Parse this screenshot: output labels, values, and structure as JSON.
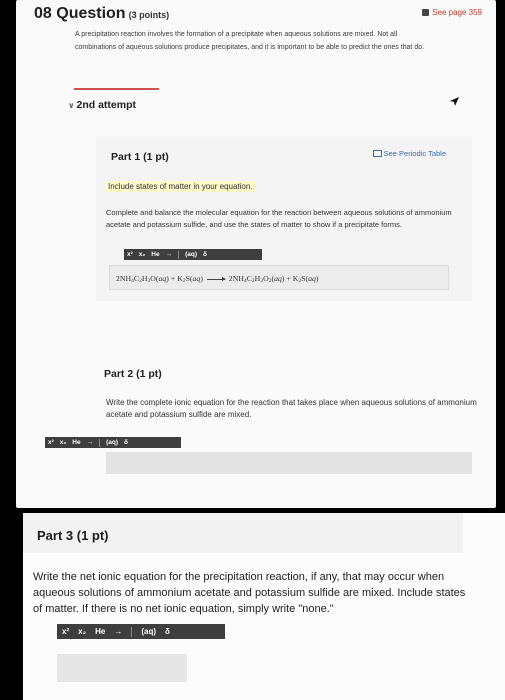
{
  "question": {
    "number_title": "08 Question",
    "points": "(3 points)",
    "see_page": "See page 359",
    "intro": "A precipitation reaction involves the formation of a precipitate when aqueous solutions are mixed. Not all combinations of aqueous solutions produce precipitates, and it is important to be able to predict the ones that do."
  },
  "attempt": {
    "label": "2nd attempt"
  },
  "part1": {
    "title": "Part 1 (1 pt)",
    "periodic_table": "See Periodic Table",
    "states_note": "Include states of matter in your equation.",
    "instructions": "Complete and balance the molecular equation for the reaction between aqueous solutions of ammonium acetate and potassium sulfide, and use the states of matter to show if a precipitate forms.",
    "toolbar": [
      "x²",
      "x₂",
      "He",
      "→",
      "(aq)",
      "δ"
    ]
  },
  "part2": {
    "title": "Part 2 (1 pt)",
    "instructions": "Write the complete ionic equation for the reaction that takes place when aqueous solutions of ammonium acetate and potassium sulfide are mixed.",
    "toolbar": [
      "x²",
      "x₂",
      "He",
      "→",
      "(aq)",
      "δ"
    ]
  },
  "part3": {
    "title": "Part 3 (1 pt)",
    "instructions": "Write the net ionic equation for the precipitation reaction, if any, that may occur when aqueous solutions of ammonium acetate and potassium sulfide are mixed. Include states of matter. If there is no net ionic equation, simply write \"none.\"",
    "toolbar": [
      "x²",
      "x₂",
      "He",
      "→",
      "(aq)",
      "δ"
    ]
  },
  "icons": {
    "see_page": "book-icon",
    "periodic_table": "periodic-table-icon",
    "attempt_toggle": "chevron-down-icon",
    "pointer": "cursor-arrow-icon"
  },
  "colors": {
    "accent_red": "#d05050",
    "link_blue": "#3b6cb5",
    "highlight": "#fff8c9",
    "toolbar": "#3e3e3e"
  }
}
